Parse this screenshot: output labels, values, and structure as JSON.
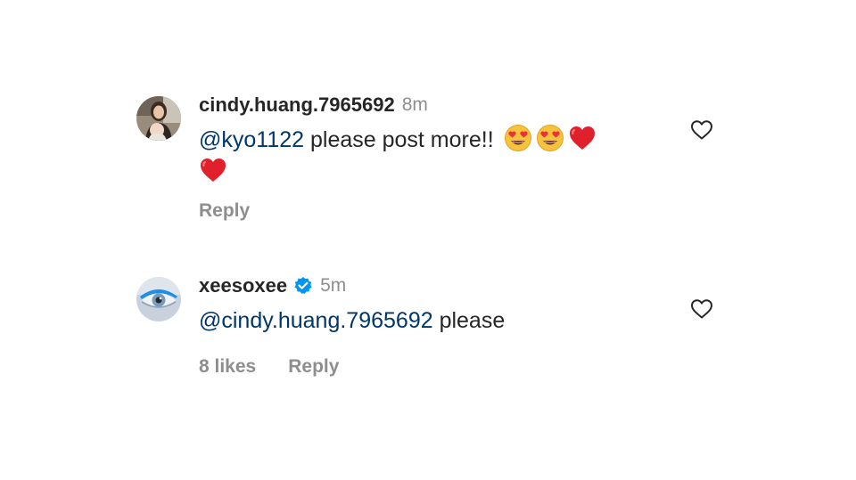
{
  "comments": [
    {
      "username": "cindy.huang.7965692",
      "time": "8m",
      "mention": "@kyo1122",
      "text": " please post more!! ",
      "emojis": [
        "heart-eyes-icon",
        "heart-eyes-icon",
        "red-heart-icon",
        "red-heart-icon"
      ],
      "likes": "",
      "reply_label": "Reply",
      "verified": false
    },
    {
      "username": "xeesoxee",
      "time": "5m",
      "mention": "@cindy.huang.7965692",
      "text": " please",
      "likes": "8 likes",
      "reply_label": "Reply",
      "verified": true
    }
  ],
  "colors": {
    "mention": "#00376b",
    "secondary_text": "#8e8e8e",
    "verified_badge": "#0095f6"
  }
}
